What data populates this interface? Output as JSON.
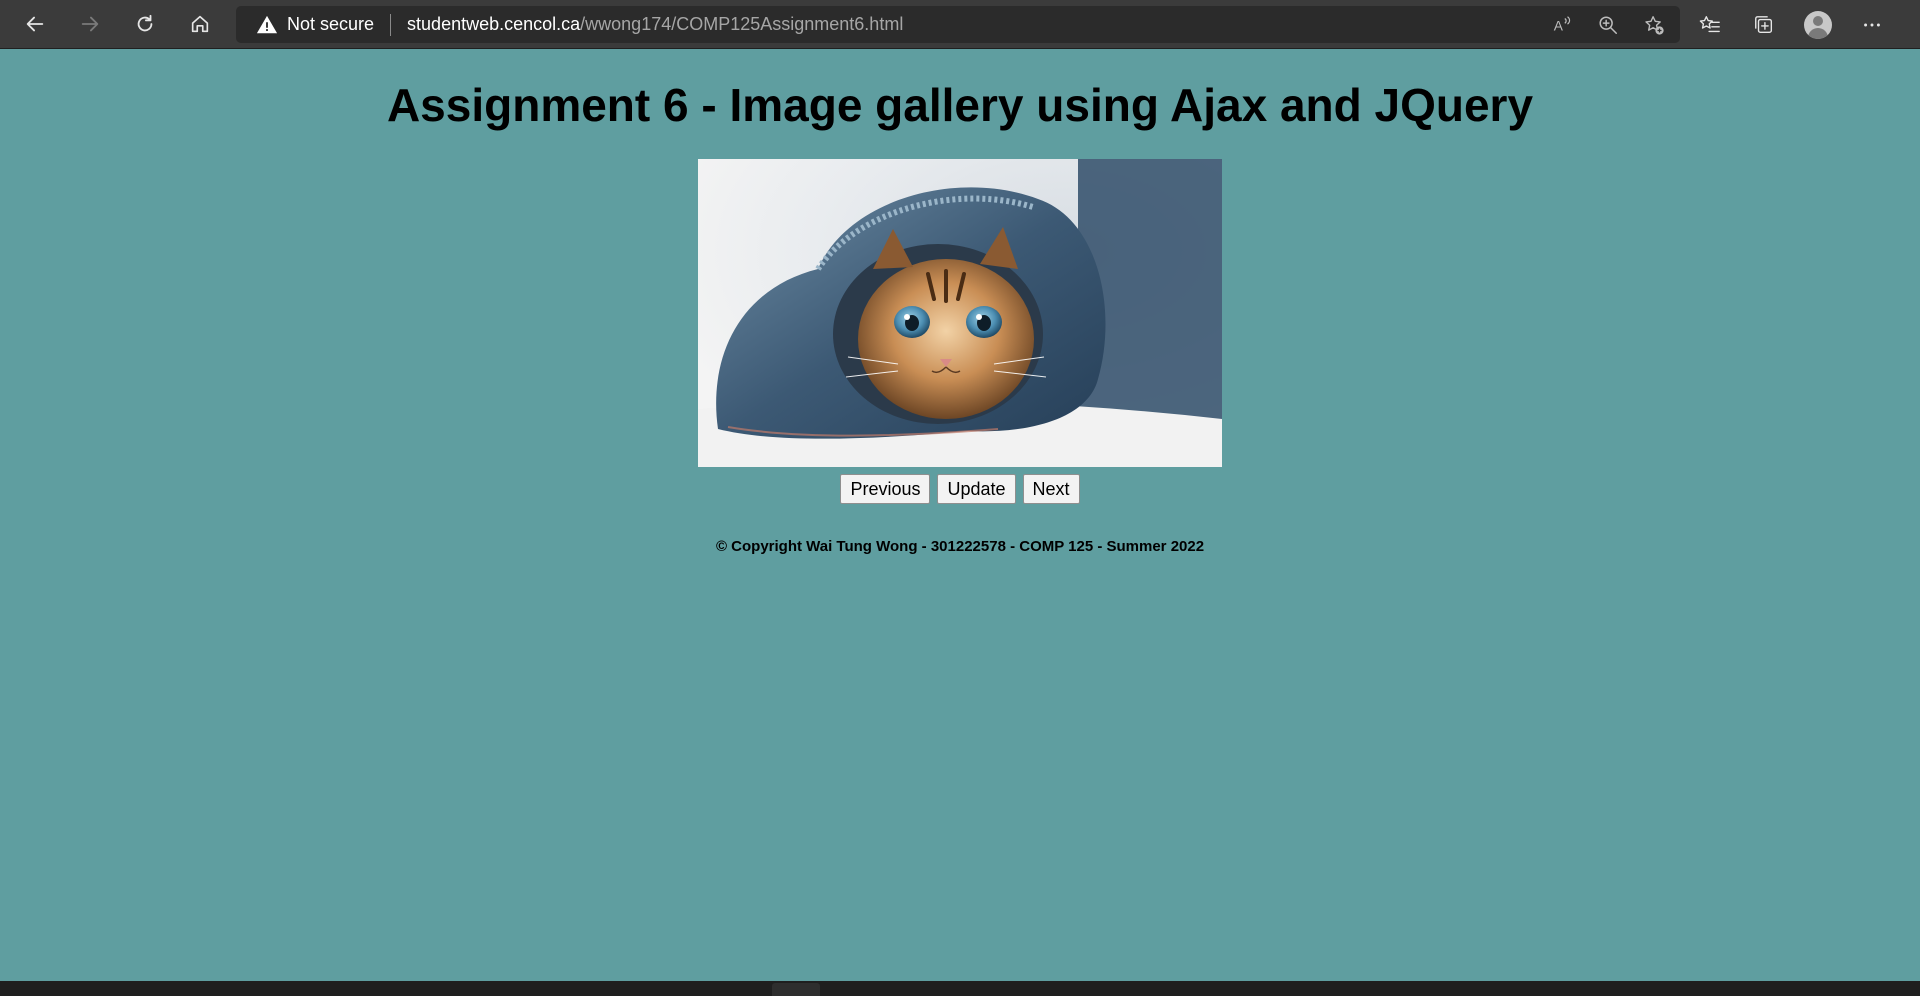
{
  "browser": {
    "security_label": "Not secure",
    "url_host": "studentweb.cencol.ca",
    "url_path": "/wwong174/COMP125Assignment6.html",
    "icons": [
      "back-icon",
      "forward-icon",
      "refresh-icon",
      "home-icon",
      "warning-icon",
      "read-aloud-icon",
      "zoom-icon",
      "add-favorite-icon",
      "favorites-icon",
      "collections-icon",
      "profile-icon",
      "more-icon"
    ]
  },
  "page": {
    "title": "Assignment 6 - Image gallery using Ajax and JQuery",
    "image_subject": "kitten",
    "buttons": {
      "previous": "Previous",
      "update": "Update",
      "next": "Next"
    },
    "footer": "© Copyright Wai Tung Wong - 301222578 - COMP 125 - Summer 2022"
  },
  "colors": {
    "page_background": "#5f9ea0",
    "toolbar_background": "#3b3b3b",
    "address_background": "#2b2b2b"
  }
}
